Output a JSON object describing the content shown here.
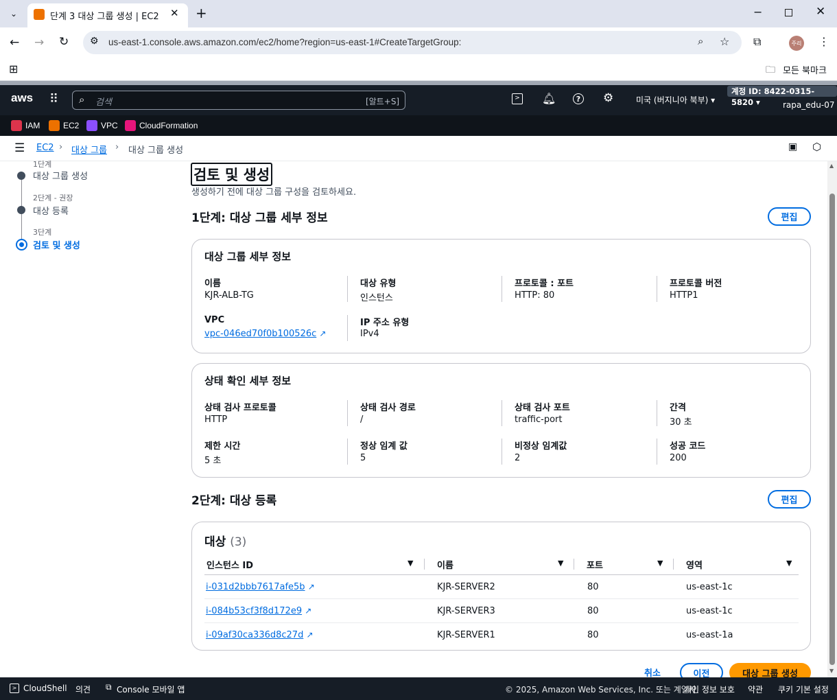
{
  "browser": {
    "tab_title": "단계 3 대상 그룹 생성 | EC2 | u",
    "url": "us-east-1.console.aws.amazon.com/ec2/home?region=us-east-1#CreateTargetGroup:",
    "bookmarks_label": "모든 북마크",
    "profile": "주리"
  },
  "aws": {
    "logo": "aws",
    "search_placeholder": "검색",
    "search_shortcut": "[알트+S]",
    "region": "미국 (버지니아 북부)",
    "account": "계정 ID: 8422-0315-5820",
    "user": "rapa_edu-07",
    "favorites": [
      "IAM",
      "EC2",
      "VPC",
      "CloudFormation"
    ]
  },
  "breadcrumb": {
    "items": [
      "EC2",
      "대상 그룹",
      "대상 그룹 생성"
    ]
  },
  "steps": [
    {
      "num": "1단계",
      "label": "대상 그룹 생성"
    },
    {
      "num": "2단계 - 권장",
      "label": "대상 등록"
    },
    {
      "num": "3단계",
      "label": "검토 및 생성"
    }
  ],
  "page": {
    "title": "검토 및 생성",
    "subtitle": "생성하기 전에 대상 그룹 구성을 검토하세요.",
    "step1_heading": "1단계: 대상 그룹 세부 정보",
    "edit": "편집",
    "step2_heading": "2단계: 대상 등록"
  },
  "details": {
    "title": "대상 그룹 세부 정보",
    "name_k": "이름",
    "name_v": "KJR-ALB-TG",
    "type_k": "대상 유형",
    "type_v": "인스턴스",
    "proto_k": "프로토콜 : 포트",
    "proto_v": "HTTP: 80",
    "ver_k": "프로토콜 버전",
    "ver_v": "HTTP1",
    "vpc_k": "VPC",
    "vpc_v": "vpc-046ed70f0b100526c",
    "ip_k": "IP 주소 유형",
    "ip_v": "IPv4"
  },
  "health": {
    "title": "상태 확인 세부 정보",
    "p_k": "상태 검사 프로토콜",
    "p_v": "HTTP",
    "path_k": "상태 검사 경로",
    "path_v": "/",
    "port_k": "상태 검사 포트",
    "port_v": "traffic-port",
    "int_k": "간격",
    "int_v": "30 초",
    "to_k": "제한 시간",
    "to_v": "5 초",
    "h_k": "정상 임계 값",
    "h_v": "5",
    "u_k": "비정상 임계값",
    "u_v": "2",
    "s_k": "성공 코드",
    "s_v": "200"
  },
  "targets": {
    "title": "대상",
    "count": "(3)",
    "headers": [
      "인스턴스 ID",
      "이름",
      "포트",
      "영역"
    ],
    "rows": [
      [
        "i-031d2bbb7617afe5b",
        "KJR-SERVER2",
        "80",
        "us-east-1c"
      ],
      [
        "i-084b53cf3f8d172e9",
        "KJR-SERVER3",
        "80",
        "us-east-1c"
      ],
      [
        "i-09af30ca336d8c27d",
        "KJR-SERVER1",
        "80",
        "us-east-1a"
      ]
    ]
  },
  "actions": {
    "cancel": "취소",
    "prev": "이전",
    "create": "대상 그룹 생성"
  },
  "footer": {
    "cloudshell": "CloudShell",
    "feedback": "의견",
    "mobile": "Console 모바일 앱",
    "copyright": "© 2025, Amazon Web Services, Inc. 또는 계열사.",
    "privacy": "개인 정보 보호",
    "terms": "약관",
    "cookies": "쿠키 기본 설정"
  },
  "colors": {
    "accent": "#006ce0",
    "primary_button": "#ff9900",
    "header": "#161d26"
  }
}
